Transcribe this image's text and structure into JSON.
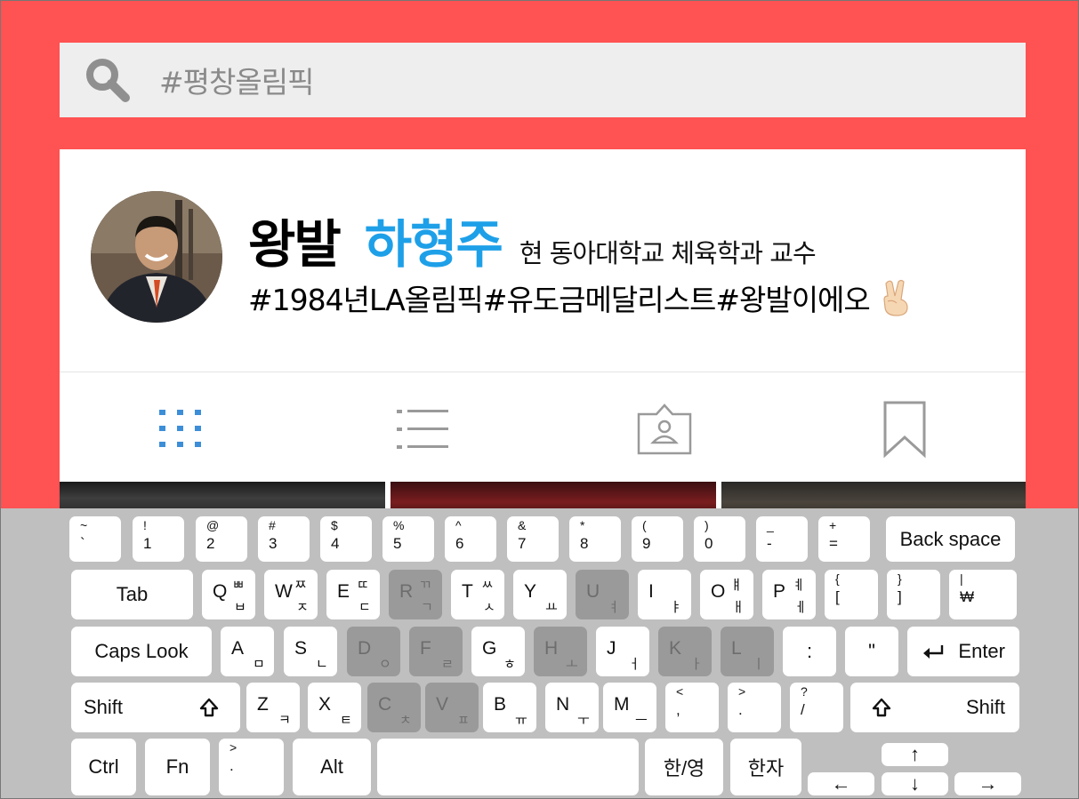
{
  "search": {
    "text": "#평창올림픽"
  },
  "profile": {
    "name_given": "왕발",
    "name_full": "하형주",
    "title": "현 동아대학교 체육학과 교수",
    "hashtags": "#1984년LA올림픽#유도금메달리스트#왕발이에오"
  },
  "tabs": [
    {
      "icon": "grid-icon",
      "active": true
    },
    {
      "icon": "list-icon",
      "active": false
    },
    {
      "icon": "tagged-person-icon",
      "active": false
    },
    {
      "icon": "bookmark-icon",
      "active": false
    }
  ],
  "colors": {
    "accent": "#ff5252",
    "name_blue": "#1ea0e8",
    "tab_active": "#3d8ed8",
    "keyboard_bg": "#bfbfbf",
    "key_highlight": "#9a9a9a"
  },
  "keyboard": {
    "r1": [
      {
        "top": "~",
        "bot": "`"
      },
      {
        "top": "!",
        "bot": "1"
      },
      {
        "top": "@",
        "bot": "2"
      },
      {
        "top": "#",
        "bot": "3"
      },
      {
        "top": "$",
        "bot": "4"
      },
      {
        "top": "%",
        "bot": "5"
      },
      {
        "top": "^",
        "bot": "6"
      },
      {
        "top": "&",
        "bot": "7"
      },
      {
        "top": "*",
        "bot": "8"
      },
      {
        "top": "(",
        "bot": "9"
      },
      {
        "top": ")",
        "bot": "0"
      },
      {
        "top": "_",
        "bot": "-"
      },
      {
        "top": "+",
        "bot": "="
      }
    ],
    "backspace": "Back space",
    "tab": "Tab",
    "r2": [
      {
        "l": "Q",
        "j1": "ㅃ",
        "j2": "ㅂ"
      },
      {
        "l": "W",
        "j1": "ㅉ",
        "j2": "ㅈ"
      },
      {
        "l": "E",
        "j1": "ㄸ",
        "j2": "ㄷ"
      },
      {
        "l": "R",
        "j1": "ㄲ",
        "j2": "ㄱ"
      },
      {
        "l": "T",
        "j1": "ㅆ",
        "j2": "ㅅ"
      },
      {
        "l": "Y",
        "j1": "",
        "j2": "ㅛ"
      },
      {
        "l": "U",
        "j1": "",
        "j2": "ㅕ"
      },
      {
        "l": "I",
        "j1": "",
        "j2": "ㅑ"
      },
      {
        "l": "O",
        "j1": "ㅒ",
        "j2": "ㅐ"
      },
      {
        "l": "P",
        "j1": "ㅖ",
        "j2": "ㅔ"
      }
    ],
    "r2p": [
      {
        "top": "{",
        "bot": "["
      },
      {
        "top": "}",
        "bot": "]"
      },
      {
        "top": "|",
        "bot": "₩"
      }
    ],
    "caps": "Caps Look",
    "r3": [
      {
        "l": "A",
        "j2": "ㅁ"
      },
      {
        "l": "S",
        "j2": "ㄴ"
      },
      {
        "l": "D",
        "j2": "ㅇ"
      },
      {
        "l": "F",
        "j2": "ㄹ"
      },
      {
        "l": "G",
        "j2": "ㅎ"
      },
      {
        "l": "H",
        "j2": "ㅗ"
      },
      {
        "l": "J",
        "j2": "ㅓ"
      },
      {
        "l": "K",
        "j2": "ㅏ"
      },
      {
        "l": "L",
        "j2": "ㅣ"
      }
    ],
    "colon": ":",
    "quote": "\"",
    "enter": "Enter",
    "shift": "Shift",
    "r4": [
      {
        "l": "Z",
        "j2": "ㅋ"
      },
      {
        "l": "X",
        "j2": "ㅌ"
      },
      {
        "l": "C",
        "j2": "ㅊ"
      },
      {
        "l": "V",
        "j2": "ㅍ"
      },
      {
        "l": "B",
        "j2": "ㅠ"
      },
      {
        "l": "N",
        "j2": "ㅜ"
      },
      {
        "l": "M",
        "j2": "ㅡ"
      }
    ],
    "r4p": [
      {
        "top": "<",
        "bot": ","
      },
      {
        "top": ">",
        "bot": "."
      },
      {
        "top": "?",
        "bot": "/"
      }
    ],
    "ctrl": "Ctrl",
    "fn": "Fn",
    "gt": {
      "top": ">",
      "bot": "."
    },
    "alt": "Alt",
    "hanyeong": "한/영",
    "hanja": "한자",
    "arrows": {
      "up": "↑",
      "left": "←",
      "down": "↓",
      "right": "→"
    }
  }
}
